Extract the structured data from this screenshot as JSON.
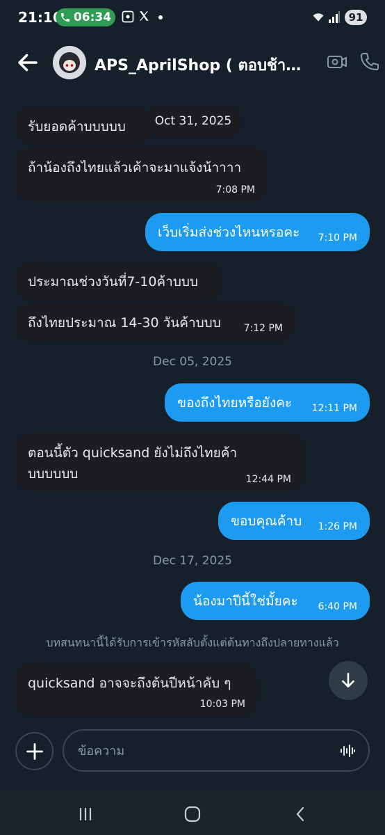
{
  "status_bar": {
    "time": "21:16",
    "call_timer": "06:34",
    "battery": "91"
  },
  "header": {
    "title": "APS_AprilShop ( ตอบช้า…"
  },
  "messages": [
    {
      "text": "รับยอดค้าบบบบบ",
      "time": ""
    },
    {
      "text": "Oct 31, 2025",
      "time": ""
    },
    {
      "text": "ถ้าน้องถึงไทยแล้วเค้าจะมาแจ้งน้าาาา",
      "time": "7:08 PM"
    },
    {
      "text": "เว็บเริ่มส่งช่วงไหนหรอคะ",
      "time": "7:10 PM"
    },
    {
      "text": "ประมาณช่วงวันที่7-10ค้าบบบ",
      "time": ""
    },
    {
      "text": "ถึงไทยประมาณ 14-30 วันค้าบบบ",
      "time": "7:12 PM"
    },
    {
      "text": "ของถึงไทยหรือยังคะ",
      "time": "12:11 PM"
    },
    {
      "text": "ตอนนี้ตัว quicksand ยังไม่ถึงไทยค้า",
      "text2": "บบบบบบ",
      "time": "12:44 PM"
    },
    {
      "text": "ขอบคุณค้าบ",
      "time": "1:26 PM"
    },
    {
      "text": "น้องมาปีนี้ใช่มั้ยคะ",
      "time": "6:40 PM"
    },
    {
      "text": "quicksand อาจจะถึงต้นปีหน้าคับ ๆ",
      "time": "10:03 PM"
    }
  ],
  "date_separators": [
    "Dec 05, 2025",
    "Dec 17, 2025"
  ],
  "encryption_notice": "บทสนทนานี้ได้รับการเข้ารหัสลับตั้งแต่ต้นทางถึงปลายทางแล้ว",
  "composer": {
    "placeholder": "ข้อความ"
  },
  "icons": {
    "back": "arrow-left-icon",
    "video": "video-call-icon",
    "phone": "phone-icon",
    "scroll": "arrow-down-icon",
    "add": "plus-icon",
    "voice": "voice-wave-icon",
    "nav_recents": "recents-icon",
    "nav_home": "home-icon",
    "nav_back": "nav-back-icon"
  },
  "colors": {
    "background": "#15202b",
    "outgoing_bubble": "#1d9bf0",
    "incoming_bubble": "#1b1d20",
    "call_pill": "#2e9c52",
    "muted_text": "#8b98a5"
  }
}
